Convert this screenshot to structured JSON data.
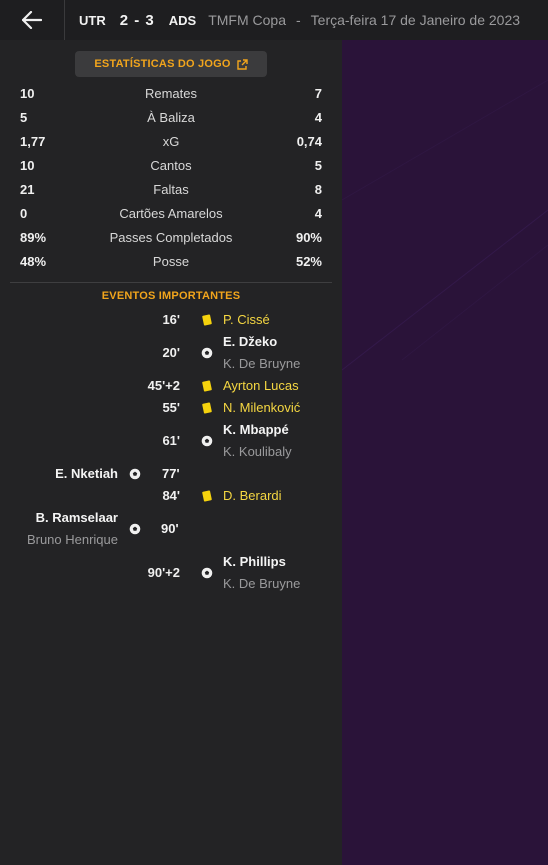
{
  "header": {
    "home_team": "UTR",
    "score": "2 - 3",
    "away_team": "ADS",
    "competition": "TMFM Copa",
    "separator": "-",
    "date": "Terça-feira 17 de Janeiro de 2023"
  },
  "stats_button": {
    "label": "ESTATÍSTICAS DO JOGO",
    "icon": "external-link-icon"
  },
  "stats": [
    {
      "label": "Remates",
      "home": "10",
      "away": "7"
    },
    {
      "label": "À Baliza",
      "home": "5",
      "away": "4"
    },
    {
      "label": "xG",
      "home": "1,77",
      "away": "0,74"
    },
    {
      "label": "Cantos",
      "home": "10",
      "away": "5"
    },
    {
      "label": "Faltas",
      "home": "21",
      "away": "8"
    },
    {
      "label": "Cartões Amarelos",
      "home": "0",
      "away": "4"
    },
    {
      "label": "Passes Completados",
      "home": "89%",
      "away": "90%"
    },
    {
      "label": "Posse",
      "home": "48%",
      "away": "52%"
    }
  ],
  "events_title": "EVENTOS IMPORTANTES",
  "events": [
    {
      "minute": "16'",
      "type": "yellow-card",
      "side": "away",
      "player": "P. Cissé"
    },
    {
      "minute": "20'",
      "type": "goal",
      "side": "away",
      "player": "E. Džeko",
      "assist": "K. De Bruyne"
    },
    {
      "minute": "45'+2",
      "type": "yellow-card",
      "side": "away",
      "player": "Ayrton Lucas"
    },
    {
      "minute": "55'",
      "type": "yellow-card",
      "side": "away",
      "player": "N. Milenković"
    },
    {
      "minute": "61'",
      "type": "goal",
      "side": "away",
      "player": "K. Mbappé",
      "assist": "K. Koulibaly"
    },
    {
      "minute": "77'",
      "type": "goal",
      "side": "home",
      "player": "E. Nketiah"
    },
    {
      "minute": "84'",
      "type": "yellow-card",
      "side": "away",
      "player": "D. Berardi"
    },
    {
      "minute": "90'",
      "type": "goal",
      "side": "home",
      "player": "B. Ramselaar",
      "assist": "Bruno Henrique"
    },
    {
      "minute": "90'+2",
      "type": "goal",
      "side": "away",
      "player": "K. Phillips",
      "assist": "K. De Bruyne"
    }
  ],
  "colors": {
    "accent": "#f2a51c",
    "yellow_card": "#f5d20d",
    "background": "#232325",
    "right_panel": "#2a1339"
  }
}
